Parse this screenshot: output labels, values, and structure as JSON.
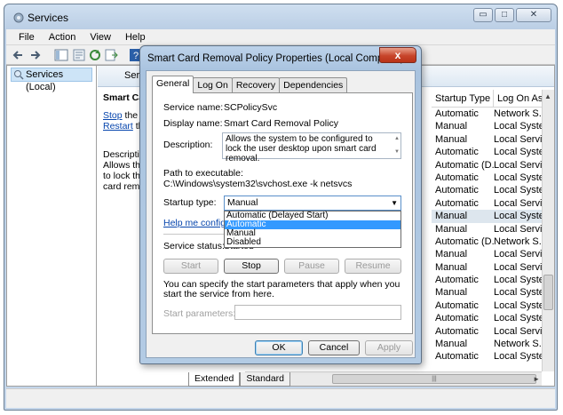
{
  "window": {
    "title": "Services",
    "controls": {
      "minimize": "▭",
      "maximize": "□",
      "close": "✕"
    }
  },
  "menu": [
    "File",
    "Action",
    "View",
    "Help"
  ],
  "left_pane": {
    "node": "Services (Local)"
  },
  "right_pane": {
    "header": "Servic",
    "desc": {
      "title": "Smart Card",
      "stop_link": "Stop",
      "stop_rest": " the se",
      "restart_link": "Restart",
      "restart_rest": " the",
      "desc_lines": [
        "Descriptio",
        "Allows the s",
        "to lock the",
        "card remov"
      ]
    },
    "columns": {
      "startup_type": "Startup Type",
      "log_on_as": "Log On As"
    },
    "rows": [
      {
        "startup": "Automatic",
        "logon": "Network S..."
      },
      {
        "startup": "Manual",
        "logon": "Local Syste..."
      },
      {
        "startup": "Manual",
        "logon": "Local Service"
      },
      {
        "startup": "Automatic",
        "logon": "Local Syste..."
      },
      {
        "startup": "Automatic (D...",
        "logon": "Local Service"
      },
      {
        "startup": "Automatic",
        "logon": "Local Syste..."
      },
      {
        "startup": "Automatic",
        "logon": "Local Syste..."
      },
      {
        "startup": "Automatic",
        "logon": "Local Service"
      },
      {
        "startup": "Manual",
        "logon": "Local Syste..."
      },
      {
        "startup": "Manual",
        "logon": "Local Service"
      },
      {
        "startup": "Automatic (D...",
        "logon": "Network S..."
      },
      {
        "startup": "Manual",
        "logon": "Local Service"
      },
      {
        "startup": "Manual",
        "logon": "Local Service"
      },
      {
        "startup": "Automatic",
        "logon": "Local Syste..."
      },
      {
        "startup": "Manual",
        "logon": "Local Syste..."
      },
      {
        "startup": "Automatic",
        "logon": "Local Syste..."
      },
      {
        "startup": "Automatic",
        "logon": "Local Syste..."
      },
      {
        "startup": "Automatic",
        "logon": "Local Service"
      },
      {
        "startup": "Manual",
        "logon": "Network S..."
      },
      {
        "startup": "Automatic",
        "logon": "Local Syste..."
      }
    ],
    "bottom_tabs": [
      "Extended",
      "Standard"
    ],
    "hscroll_grip": "|||"
  },
  "dialog": {
    "title": "Smart Card Removal Policy Properties (Local Computer)",
    "close": "x",
    "tabs": [
      "General",
      "Log On",
      "Recovery",
      "Dependencies"
    ],
    "service_name_label": "Service name:",
    "service_name": "SCPolicySvc",
    "display_name_label": "Display name:",
    "display_name": "Smart Card Removal Policy",
    "description_label": "Description:",
    "description": "Allows the system to be configured to lock the user desktop upon smart card removal.",
    "path_label": "Path to executable:",
    "path": "C:\\Windows\\system32\\svchost.exe -k netsvcs",
    "startup_type_label": "Startup type:",
    "startup_type_value": "Manual",
    "startup_options": [
      "Automatic (Delayed Start)",
      "Automatic",
      "Manual",
      "Disabled"
    ],
    "help_link": "Help me configure s",
    "service_status_label": "Service status:",
    "service_status": "Started",
    "buttons": {
      "start": "Start",
      "stop": "Stop",
      "pause": "Pause",
      "resume": "Resume"
    },
    "params_note": "You can specify the start parameters that apply when you start the service from here.",
    "start_params_label": "Start parameters:",
    "ok": "OK",
    "cancel": "Cancel",
    "apply": "Apply"
  }
}
